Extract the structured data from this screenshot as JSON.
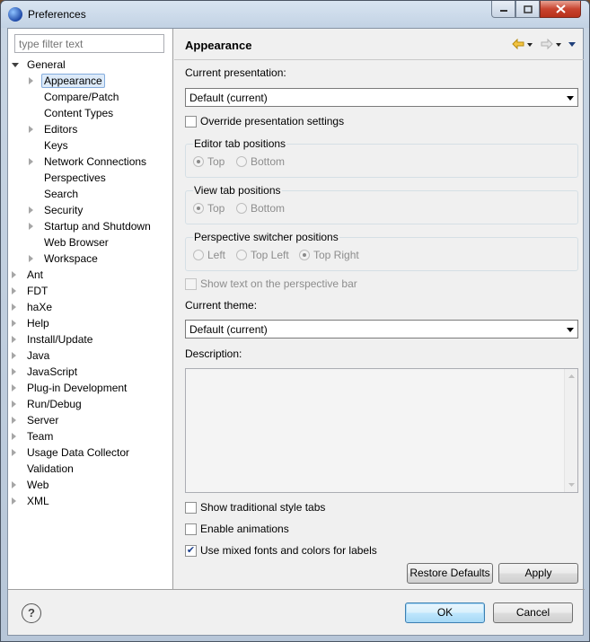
{
  "window": {
    "title": "Preferences"
  },
  "filter": {
    "placeholder": "type filter text"
  },
  "tree": [
    {
      "label": "General",
      "depth": 0,
      "arrow": "open"
    },
    {
      "label": "Appearance",
      "depth": 1,
      "arrow": "closed",
      "selected": true
    },
    {
      "label": "Compare/Patch",
      "depth": 1,
      "arrow": "none"
    },
    {
      "label": "Content Types",
      "depth": 1,
      "arrow": "none"
    },
    {
      "label": "Editors",
      "depth": 1,
      "arrow": "closed"
    },
    {
      "label": "Keys",
      "depth": 1,
      "arrow": "none"
    },
    {
      "label": "Network Connections",
      "depth": 1,
      "arrow": "closed"
    },
    {
      "label": "Perspectives",
      "depth": 1,
      "arrow": "none"
    },
    {
      "label": "Search",
      "depth": 1,
      "arrow": "none"
    },
    {
      "label": "Security",
      "depth": 1,
      "arrow": "closed"
    },
    {
      "label": "Startup and Shutdown",
      "depth": 1,
      "arrow": "closed"
    },
    {
      "label": "Web Browser",
      "depth": 1,
      "arrow": "none"
    },
    {
      "label": "Workspace",
      "depth": 1,
      "arrow": "closed"
    },
    {
      "label": "Ant",
      "depth": 0,
      "arrow": "closed"
    },
    {
      "label": "FDT",
      "depth": 0,
      "arrow": "closed"
    },
    {
      "label": "haXe",
      "depth": 0,
      "arrow": "closed"
    },
    {
      "label": "Help",
      "depth": 0,
      "arrow": "closed"
    },
    {
      "label": "Install/Update",
      "depth": 0,
      "arrow": "closed"
    },
    {
      "label": "Java",
      "depth": 0,
      "arrow": "closed"
    },
    {
      "label": "JavaScript",
      "depth": 0,
      "arrow": "closed"
    },
    {
      "label": "Plug-in Development",
      "depth": 0,
      "arrow": "closed"
    },
    {
      "label": "Run/Debug",
      "depth": 0,
      "arrow": "closed"
    },
    {
      "label": "Server",
      "depth": 0,
      "arrow": "closed"
    },
    {
      "label": "Team",
      "depth": 0,
      "arrow": "closed"
    },
    {
      "label": "Usage Data Collector",
      "depth": 0,
      "arrow": "closed"
    },
    {
      "label": "Validation",
      "depth": 0,
      "arrow": "none"
    },
    {
      "label": "Web",
      "depth": 0,
      "arrow": "closed"
    },
    {
      "label": "XML",
      "depth": 0,
      "arrow": "closed"
    }
  ],
  "page": {
    "title": "Appearance",
    "presentation_label": "Current presentation:",
    "presentation_value": "Default (current)",
    "override_label": "Override presentation settings",
    "override_checked": false,
    "editor_tab": {
      "title": "Editor tab positions",
      "top": "Top",
      "bottom": "Bottom",
      "selected": "Top"
    },
    "view_tab": {
      "title": "View tab positions",
      "top": "Top",
      "bottom": "Bottom",
      "selected": "Top"
    },
    "perspective_switcher": {
      "title": "Perspective switcher positions",
      "left": "Left",
      "top_left": "Top Left",
      "top_right": "Top Right",
      "selected": "Top Right"
    },
    "show_text_label": "Show text on the perspective bar",
    "theme_label": "Current theme:",
    "theme_value": "Default (current)",
    "description_label": "Description:",
    "traditional_tabs_label": "Show traditional style tabs",
    "traditional_tabs_checked": false,
    "animations_label": "Enable animations",
    "animations_checked": false,
    "mixed_fonts_label": "Use mixed fonts and colors for labels",
    "mixed_fonts_checked": true,
    "restore_defaults": "Restore Defaults",
    "apply": "Apply"
  },
  "footer": {
    "ok": "OK",
    "cancel": "Cancel",
    "help_symbol": "?"
  },
  "icons": {
    "back": "back-arrow-icon",
    "forward": "forward-arrow-icon",
    "menu": "view-menu-icon",
    "app": "eclipse-icon"
  },
  "colors": {
    "selection_bg": "#dceaf9",
    "selection_border": "#84acdd",
    "close_button": "#c8442f"
  }
}
